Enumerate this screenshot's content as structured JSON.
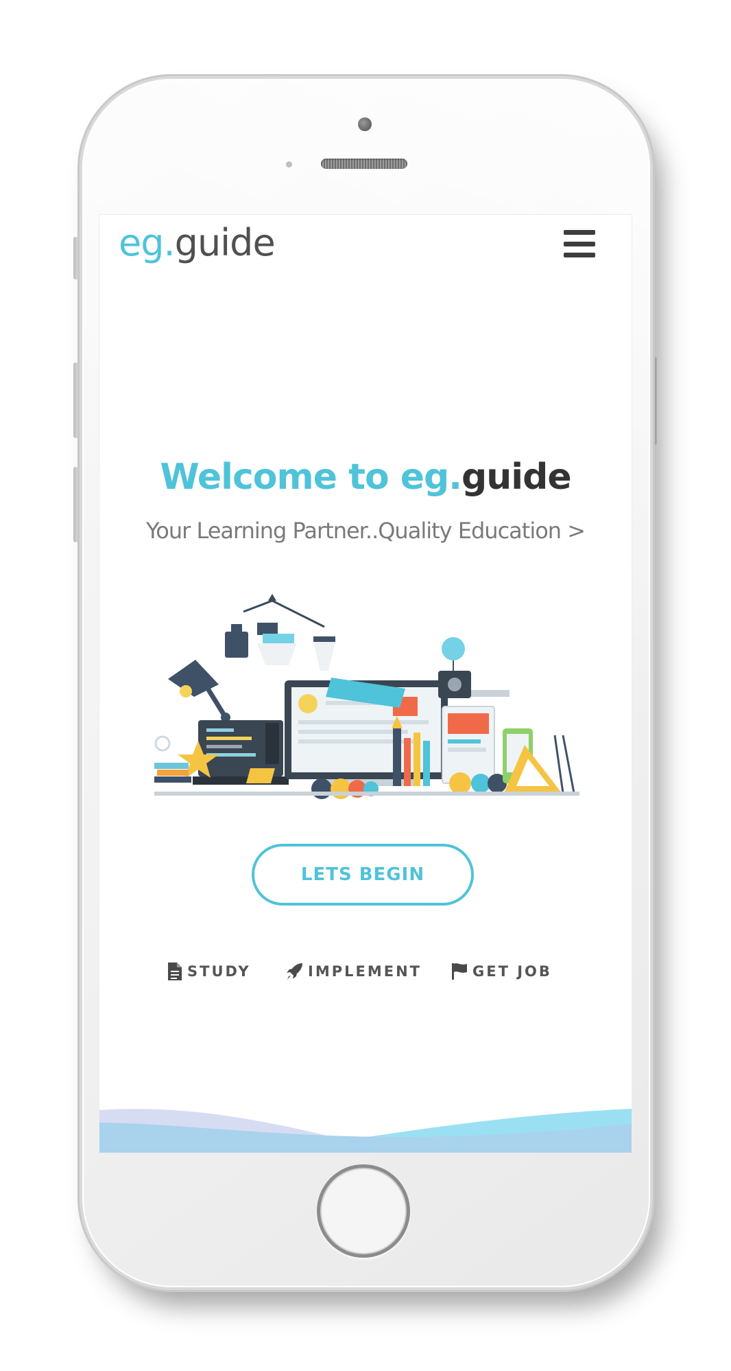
{
  "brand": {
    "logo_prefix": "eg.",
    "logo_suffix": "guide",
    "accent_color": "#4fc3d9",
    "text_color": "#505050"
  },
  "header": {
    "menu_icon": "hamburger-menu-icon"
  },
  "hero": {
    "title_prefix": "Welcome to eg.",
    "title_suffix": "guide",
    "subtitle": "Your Learning Partner..Quality Education >",
    "illustration": "workspace-illustration",
    "cta_label": "LETS BEGIN"
  },
  "features": [
    {
      "label": "STUDY",
      "icon": "document-icon"
    },
    {
      "label": "IMPLEMENT",
      "icon": "rocket-icon"
    },
    {
      "label": "GET JOB",
      "icon": "flag-icon"
    }
  ],
  "footer_wave": {
    "colors": [
      "#a9d2ec",
      "#d6dcf2",
      "#9be0f2"
    ]
  }
}
